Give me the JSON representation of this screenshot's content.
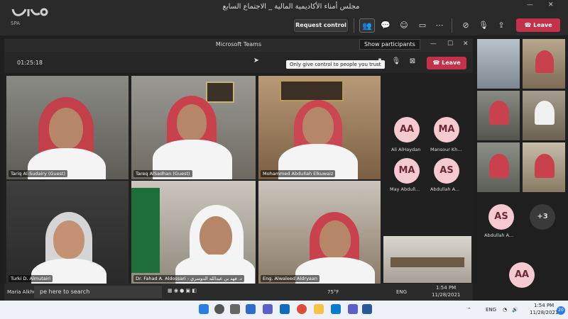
{
  "window": {
    "meeting_title": "مجلس أمناء الأكاديمية المالية _ الاجتماع السابع",
    "request_control": "Request control",
    "leave": "Leave",
    "show_participants_tooltip": "Show participants"
  },
  "logo": {
    "text": "واس",
    "sub": "SPA"
  },
  "inner": {
    "title": "Microsoft Teams",
    "timer": "01:25:18",
    "control_tooltip": "Only give control to people you trust",
    "leave": "Leave"
  },
  "tiles": [
    {
      "name": "Tariq Al-Sudairy (Guest)"
    },
    {
      "name": "Tareq AlSadhan (Guest)"
    },
    {
      "name": "Mohammed Abdullah Elkuwaiz"
    },
    {
      "name": "Turki D. Almutairi"
    },
    {
      "name": "Dr. Fahad A. Aldossari - د. فهد بن عبدالله الدوسري"
    },
    {
      "name": "Eng. Alwaleed Aldryaan"
    }
  ],
  "side_avatars": [
    {
      "initials": "AA",
      "label": "Ali AlHaydan"
    },
    {
      "initials": "MA",
      "label": "Mansour Kh..."
    },
    {
      "initials": "MA",
      "label": "May Abdull..."
    },
    {
      "initials": "AS",
      "label": "Abdullah A..."
    }
  ],
  "outer_panel": {
    "avatar_initials": "AS",
    "avatar_label": "Abdullah A...",
    "more_count": "+3",
    "bottom_initials": "AA"
  },
  "inner_taskbar": {
    "left_label": "Maria Alkhumsi",
    "search_placeholder": "pe here to search",
    "weather": "75°F",
    "lang": "ENG",
    "time": "1:54 PM",
    "date": "11/28/2021"
  },
  "taskbar": {
    "lang": "ENG",
    "time": "1:54 PM",
    "date": "11/28/2021",
    "badge": "20"
  },
  "colors": {
    "leave": "#c4314b",
    "avatar": "#f4c9cf",
    "bg": "#1f1f1f"
  }
}
